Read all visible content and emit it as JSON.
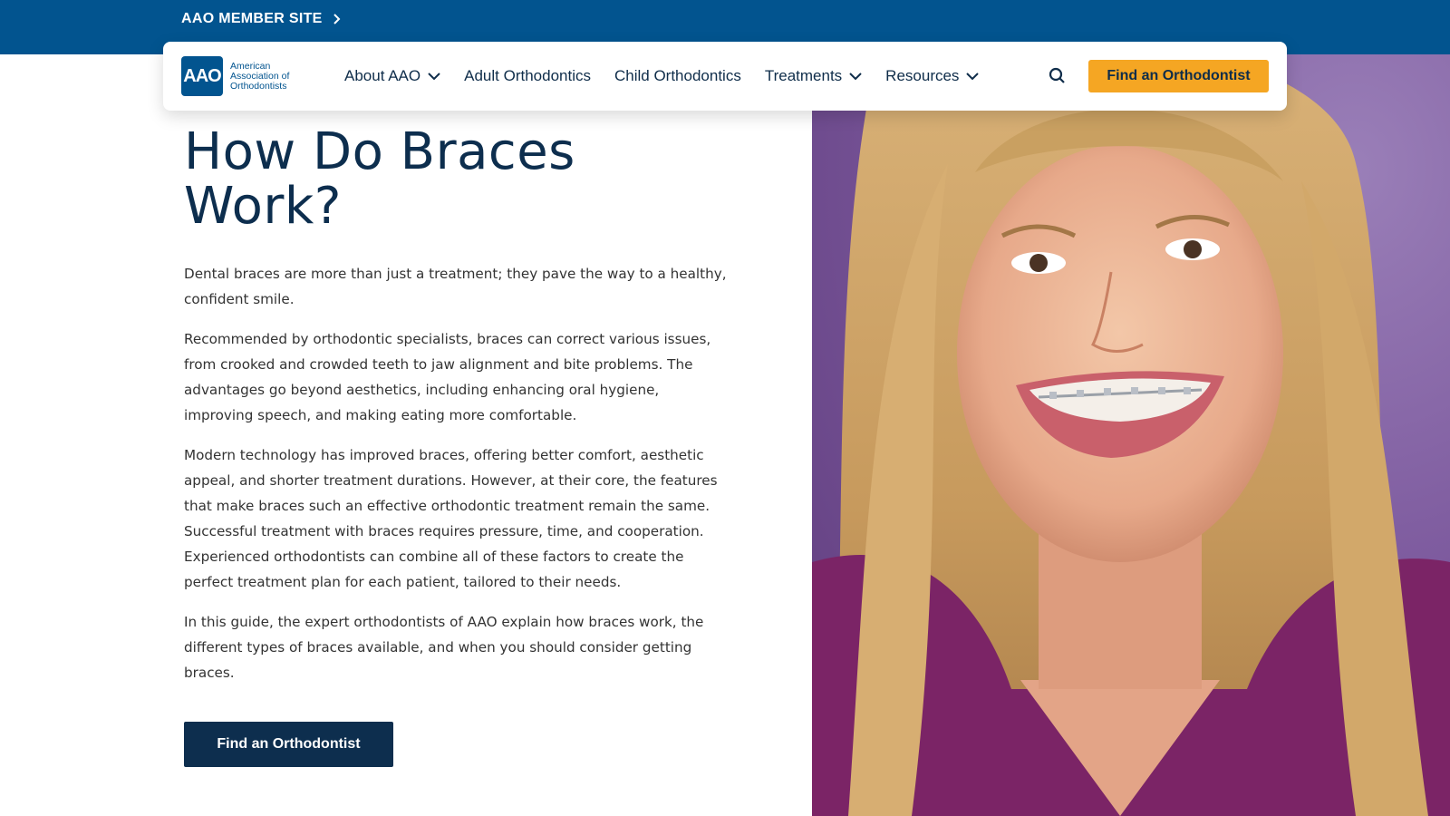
{
  "topbar": {
    "member_site_label": "AAO MEMBER SITE"
  },
  "logo": {
    "mark": "AAO",
    "line1": "American",
    "line2": "Association of",
    "line3": "Orthodontists"
  },
  "nav": {
    "items": [
      {
        "label": "About AAO",
        "has_dropdown": true
      },
      {
        "label": "Adult Orthodontics",
        "has_dropdown": false
      },
      {
        "label": "Child Orthodontics",
        "has_dropdown": false
      },
      {
        "label": "Treatments",
        "has_dropdown": true
      },
      {
        "label": "Resources",
        "has_dropdown": true
      }
    ],
    "search_icon": "search-icon",
    "cta_label": "Find an Orthodontist"
  },
  "main": {
    "title_line1": "How Do Braces",
    "title_line2": "Work?",
    "paragraphs": [
      "Dental braces are more than just a treatment; they pave the way to a healthy, confident smile.",
      "Recommended by orthodontic specialists, braces can correct various issues, from crooked and crowded teeth to jaw alignment and bite problems. The advantages go beyond aesthetics, including enhancing oral hygiene, improving speech, and making eating more comfortable.",
      "Modern technology has improved braces, offering better comfort, aesthetic appeal, and shorter treatment durations. However, at their core, the features that make braces such an effective orthodontic treatment remain the same. Successful treatment with braces requires pressure, time, and cooperation. Experienced orthodontists can combine all of these factors to create the perfect treatment plan for each patient, tailored to their needs.",
      "In this guide, the expert orthodontists of AAO explain how braces work, the different types of braces available, and when you should consider getting braces."
    ],
    "cta_label": "Find an Orthodontist"
  },
  "colors": {
    "topbar": "#02548f",
    "navy": "#0d2e4e",
    "accent": "#f5a623",
    "photo_bg": "#7d5a9e"
  }
}
